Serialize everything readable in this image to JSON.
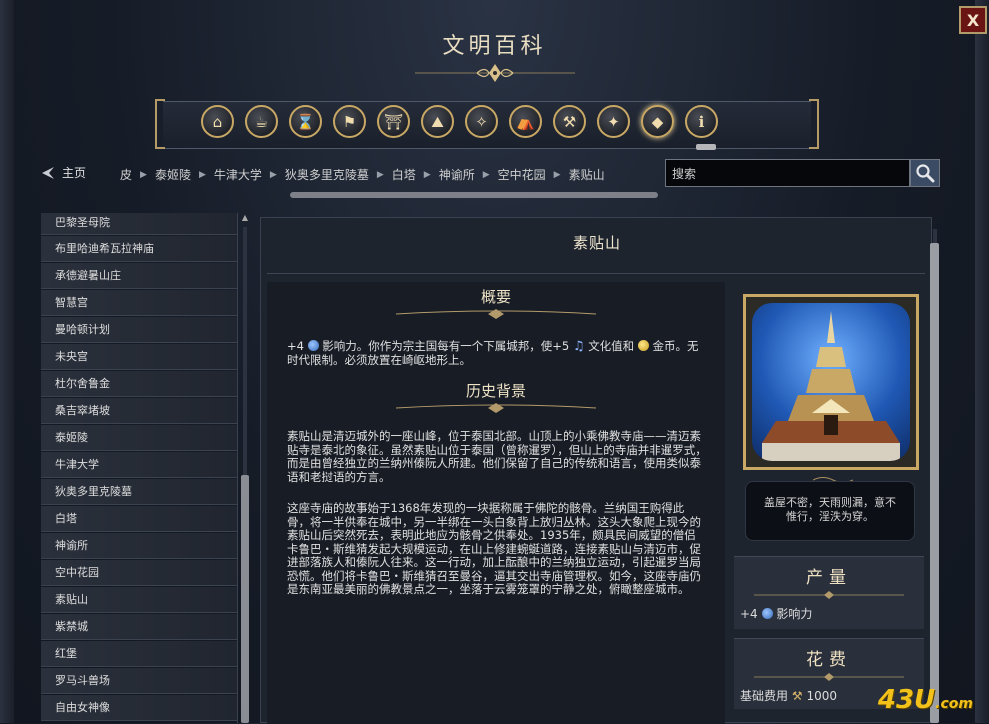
{
  "window": {
    "title": "文明百科",
    "close_label": "X"
  },
  "toolbar": {
    "icons": [
      "civilopedia-home-icon",
      "concepts-icon",
      "technologies-icon",
      "units-icon",
      "buildings-icon",
      "wonders-icon",
      "policies-icon",
      "resources-icon",
      "improvements-icon",
      "religion-icon",
      "terrain-icon",
      "great-people-icon"
    ],
    "active_index": 10
  },
  "nav": {
    "home_label": "主页",
    "breadcrumb": [
      "皮",
      "泰姬陵",
      "牛津大学",
      "狄奥多里克陵墓",
      "白塔",
      "神谕所",
      "空中花园",
      "素贴山"
    ],
    "search_value": "搜索"
  },
  "sidebar": {
    "items": [
      "巴黎圣母院",
      "布里哈迪希瓦拉神庙",
      "承德避暑山庄",
      "智慧宫",
      "曼哈顿计划",
      "未央宫",
      "杜尔舍鲁金",
      "桑吉窣堵坡",
      "泰姬陵",
      "牛津大学",
      "狄奥多里克陵墓",
      "白塔",
      "神谕所",
      "空中花园",
      "素贴山",
      "紫禁城",
      "红堡",
      "罗马斗兽场",
      "自由女神像"
    ]
  },
  "article": {
    "title": "素贴山",
    "summary_heading": "概要",
    "summary": {
      "p1": "+4",
      "p2": "影响力。你作为宗主国每有一个下属城邦，使+5",
      "p3": "文化值和",
      "p4": "金币。无时代限制。必须放置在崎岖地形上。"
    },
    "history_heading": "历史背景",
    "history_p1": "素贴山是清迈城外的一座山峰，位于泰国北部。山顶上的小乘佛教寺庙——清迈素贴寺是泰北的象征。虽然素贴山位于泰国（曾称暹罗），但山上的寺庙并非暹罗式，而是由曾经独立的兰纳州傣阮人所建。他们保留了自己的传统和语言，使用类似泰语和老挝语的方言。",
    "history_p2": "这座寺庙的故事始于1368年发现的一块据称属于佛陀的骸骨。兰纳国王购得此骨，将一半供奉在城中，另一半绑在一头白象背上放归丛林。这头大象爬上现今的素贴山后突然死去，表明此地应为骸骨之供奉处。1935年，颇具民间威望的僧侣卡鲁巴・斯维猜发起大规模运动，在山上修建蜿蜒道路，连接素贴山与清迈市，促进部落族人和傣阮人往来。这一行动，加上酝酿中的兰纳独立运动，引起暹罗当局恐慌。他们将卡鲁巴・斯维猜召至曼谷，逼其交出寺庙管理权。如今，这座寺庙仍是东南亚最美丽的佛教景点之一，坐落于云雾笼罩的宁静之处，俯瞰整座城市。"
  },
  "right_panel": {
    "quote": "盖屋不密，天雨则漏，意不惟行，淫泆为穿。",
    "yield_title": "产量",
    "yield_amount": "+4",
    "yield_label": "影响力",
    "cost_title": "花费",
    "cost_label": "基础费用",
    "cost_value": "1000"
  },
  "watermark": {
    "text": "43U",
    "suffix": ".com"
  },
  "colors": {
    "gold": "#c9a865",
    "panel": "#1e242e",
    "accent_blue": "#3b4b63"
  }
}
